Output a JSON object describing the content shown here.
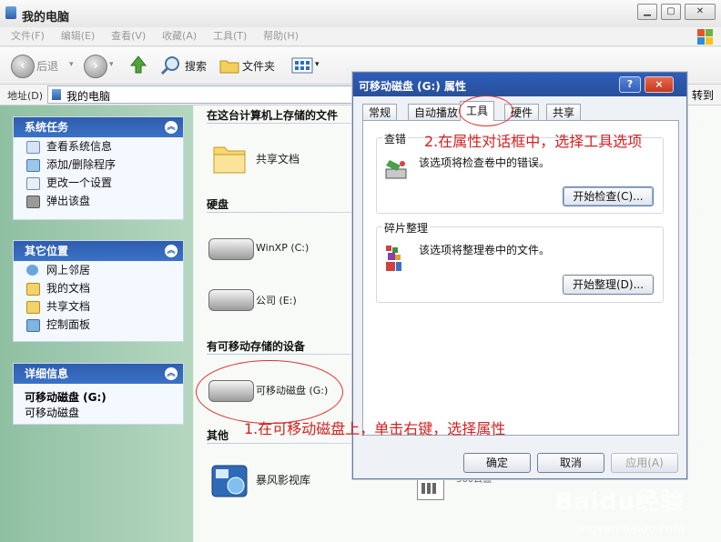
{
  "window": {
    "title": "我的电脑"
  },
  "menu": [
    "文件(F)",
    "编辑(E)",
    "查看(V)",
    "收藏(A)",
    "工具(T)",
    "帮助(H)"
  ],
  "toolbar": {
    "back": "后退",
    "search": "搜索",
    "folders": "文件夹"
  },
  "address": {
    "label": "地址(D)",
    "value": "我的电脑",
    "go": "转到"
  },
  "left": {
    "system_tasks": {
      "title": "系统任务",
      "items": [
        "查看系统信息",
        "添加/删除程序",
        "更改一个设置",
        "弹出该盘"
      ]
    },
    "other_places": {
      "title": "其它位置",
      "items": [
        "网上邻居",
        "我的文档",
        "共享文档",
        "控制面板"
      ]
    },
    "details": {
      "title": "详细信息",
      "name": "可移动磁盘 (G:)",
      "type": "可移动磁盘"
    }
  },
  "content": {
    "sec_stored": "在这台计算机上存储的文件",
    "shared_docs": "共享文档",
    "sec_hdd": "硬盘",
    "drive_c": "WinXP (C:)",
    "drive_e": "公司 (E:)",
    "sec_removable": "有可移动存储的设备",
    "drive_g": "可移动磁盘 (G:)",
    "sec_other": "其他",
    "storm": "暴风影视库",
    "cloud": "360云盘"
  },
  "dialog": {
    "title": "可移动磁盘 (G:) 属性",
    "tabs": [
      "常规",
      "自动播放",
      "工具",
      "硬件",
      "共享"
    ],
    "active_tab": "工具",
    "error_group": {
      "title": "查错",
      "desc": "该选项将检查卷中的错误。",
      "button": "开始检查(C)..."
    },
    "defrag_group": {
      "title": "碎片整理",
      "desc": "该选项将整理卷中的文件。",
      "button": "开始整理(D)..."
    },
    "ok": "确定",
    "cancel": "取消",
    "apply": "应用(A)",
    "help_btn": "?",
    "close_btn": "×"
  },
  "annotations": {
    "step1": "1.在可移动磁盘上，单击右键，选择属性",
    "step2": "2.在属性对话框中，选择工具选项"
  },
  "watermark": {
    "brand": "Baidu经验",
    "url": "jingyan.baidu.com"
  },
  "colors": {
    "accent": "#2f5cae",
    "annotation": "#d52020"
  }
}
